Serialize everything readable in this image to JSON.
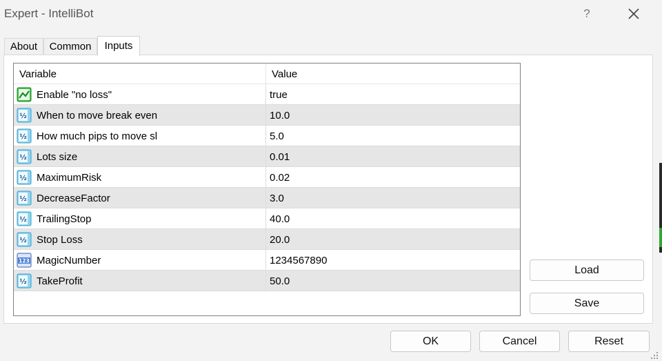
{
  "window": {
    "title": "Expert - IntelliBot",
    "help_label": "?",
    "close_label": "✕"
  },
  "tabs": [
    {
      "label": "About"
    },
    {
      "label": "Common"
    },
    {
      "label": "Inputs",
      "active": true
    }
  ],
  "grid": {
    "columns": [
      "Variable",
      "Value"
    ],
    "rows": [
      {
        "icon": "bool-icon",
        "name": "Enable \"no loss\"",
        "value": "true"
      },
      {
        "icon": "double-icon",
        "name": "When to move break even",
        "value": "10.0"
      },
      {
        "icon": "double-icon",
        "name": "How much pips to move sl",
        "value": "5.0"
      },
      {
        "icon": "double-icon",
        "name": "Lots size",
        "value": "0.01"
      },
      {
        "icon": "double-icon",
        "name": "MaximumRisk",
        "value": "0.02"
      },
      {
        "icon": "double-icon",
        "name": "DecreaseFactor",
        "value": "3.0"
      },
      {
        "icon": "double-icon",
        "name": "TrailingStop",
        "value": "40.0"
      },
      {
        "icon": "double-icon",
        "name": "Stop Loss",
        "value": "20.0"
      },
      {
        "icon": "integer-icon",
        "name": "MagicNumber",
        "value": "1234567890"
      },
      {
        "icon": "double-icon",
        "name": "TakeProfit",
        "value": "50.0"
      }
    ]
  },
  "buttons": {
    "load": "Load",
    "save": "Save",
    "ok": "OK",
    "cancel": "Cancel",
    "reset": "Reset"
  },
  "icon_glyphs": {
    "double": "½",
    "integer": "123"
  },
  "colors": {
    "double_icon_bg": "#8fd6f2",
    "integer_icon_bg": "#4a7fd6",
    "bool_icon_bg": "#3cc24a"
  }
}
